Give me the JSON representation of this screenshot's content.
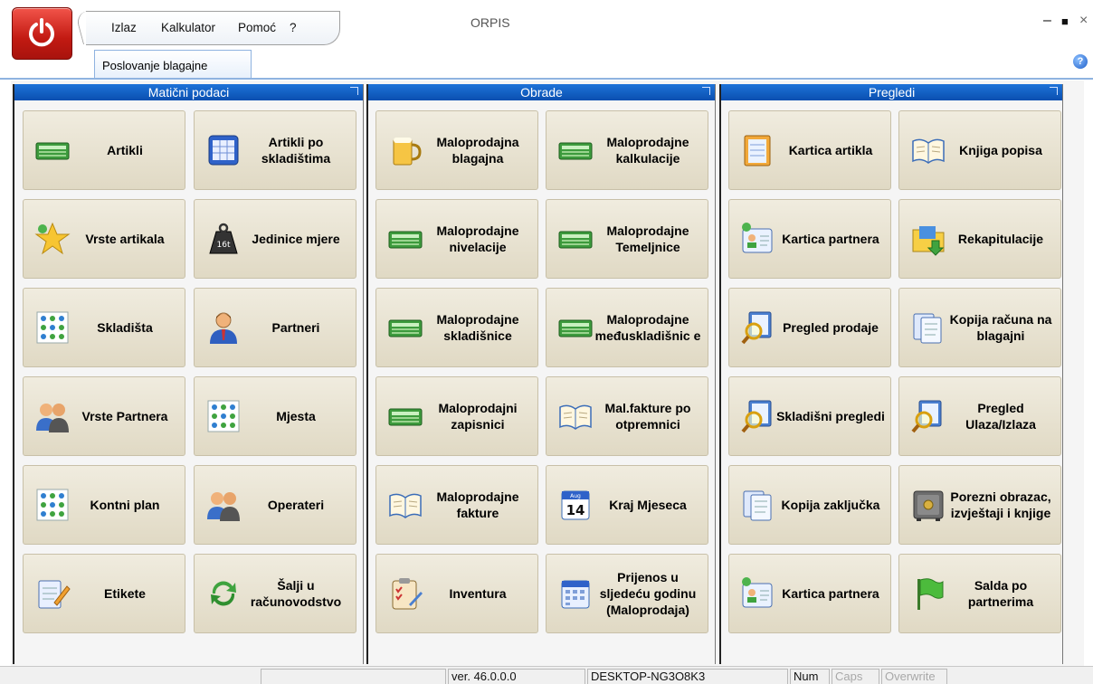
{
  "window": {
    "title": "ORPIS",
    "controls": {
      "minimize": "‒",
      "maximize": "■",
      "close": "×"
    }
  },
  "menu": {
    "items": [
      "Izlaz",
      "Kalkulator",
      "Pomoć",
      "?"
    ]
  },
  "tabs": {
    "active": "Poslovanje blagajne"
  },
  "panels": [
    {
      "title": "Matični podaci",
      "tiles": [
        {
          "label": "Artikli",
          "icon": "green-ledger-icon"
        },
        {
          "label": "Artikli po skladištima",
          "icon": "blue-calculator-icon"
        },
        {
          "label": "Vrste artikala",
          "icon": "star-icon"
        },
        {
          "label": "Jedinice mjere",
          "icon": "weight-icon"
        },
        {
          "label": "Skladišta",
          "icon": "network-grid-icon"
        },
        {
          "label": "Partneri",
          "icon": "person-icon"
        },
        {
          "label": "Vrste Partnera",
          "icon": "people-icon"
        },
        {
          "label": "Mjesta",
          "icon": "network-grid-icon"
        },
        {
          "label": "Kontni plan",
          "icon": "network-grid-icon"
        },
        {
          "label": "Operateri",
          "icon": "people-icon"
        },
        {
          "label": "Etikete",
          "icon": "edit-note-icon"
        },
        {
          "label": "Šalji u računovodstvo",
          "icon": "refresh-icon"
        }
      ]
    },
    {
      "title": "Obrade",
      "tiles": [
        {
          "label": "Maloprodajna blagajna",
          "icon": "beer-mug-icon"
        },
        {
          "label": "Maloprodajne kalkulacije",
          "icon": "green-ledger-icon"
        },
        {
          "label": "Maloprodajne nivelacije",
          "icon": "green-ledger-icon"
        },
        {
          "label": "Maloprodajne Temeljnice",
          "icon": "green-ledger-icon"
        },
        {
          "label": "Maloprodajne skladišnice",
          "icon": "green-ledger-icon"
        },
        {
          "label": "Maloprodajne međuskladišnic e",
          "icon": "green-ledger-icon"
        },
        {
          "label": "Maloprodajni zapisnici",
          "icon": "green-ledger-icon"
        },
        {
          "label": "Mal.fakture po otpremnici",
          "icon": "open-book-icon"
        },
        {
          "label": "Maloprodajne fakture",
          "icon": "open-book-icon"
        },
        {
          "label": "Kraj Mjeseca",
          "icon": "calendar-icon"
        },
        {
          "label": "Inventura",
          "icon": "clipboard-icon"
        },
        {
          "label": "Prijenos u sljedeću godinu (Maloprodaja)",
          "icon": "calendar-grid-icon"
        }
      ]
    },
    {
      "title": "Pregledi",
      "tiles": [
        {
          "label": "Kartica artikla",
          "icon": "notepad-icon"
        },
        {
          "label": "Knjiga popisa",
          "icon": "open-book-icon"
        },
        {
          "label": "Kartica partnera",
          "icon": "contact-card-icon"
        },
        {
          "label": "Rekapitulacije",
          "icon": "folder-arrow-icon"
        },
        {
          "label": "Pregled prodaje",
          "icon": "magnifier-doc-icon"
        },
        {
          "label": "Kopija računa na blagajni",
          "icon": "documents-icon"
        },
        {
          "label": "Skladišni pregledi",
          "icon": "magnifier-doc-icon"
        },
        {
          "label": "Pregled Ulaza/Izlaza",
          "icon": "magnifier-doc-icon"
        },
        {
          "label": "Kopija zaključka",
          "icon": "documents-icon"
        },
        {
          "label": "Porezni obrazac, izvještaji i knjige",
          "icon": "safe-icon"
        },
        {
          "label": "Kartica partnera",
          "icon": "contact-card-icon"
        },
        {
          "label": "Salda po partnerima",
          "icon": "green-flag-icon"
        }
      ]
    }
  ],
  "status": {
    "version": "ver. 46.0.0.0",
    "computer": "DESKTOP-NG3O8K3",
    "num": "Num",
    "caps": "Caps",
    "overwrite": "Overwrite"
  }
}
